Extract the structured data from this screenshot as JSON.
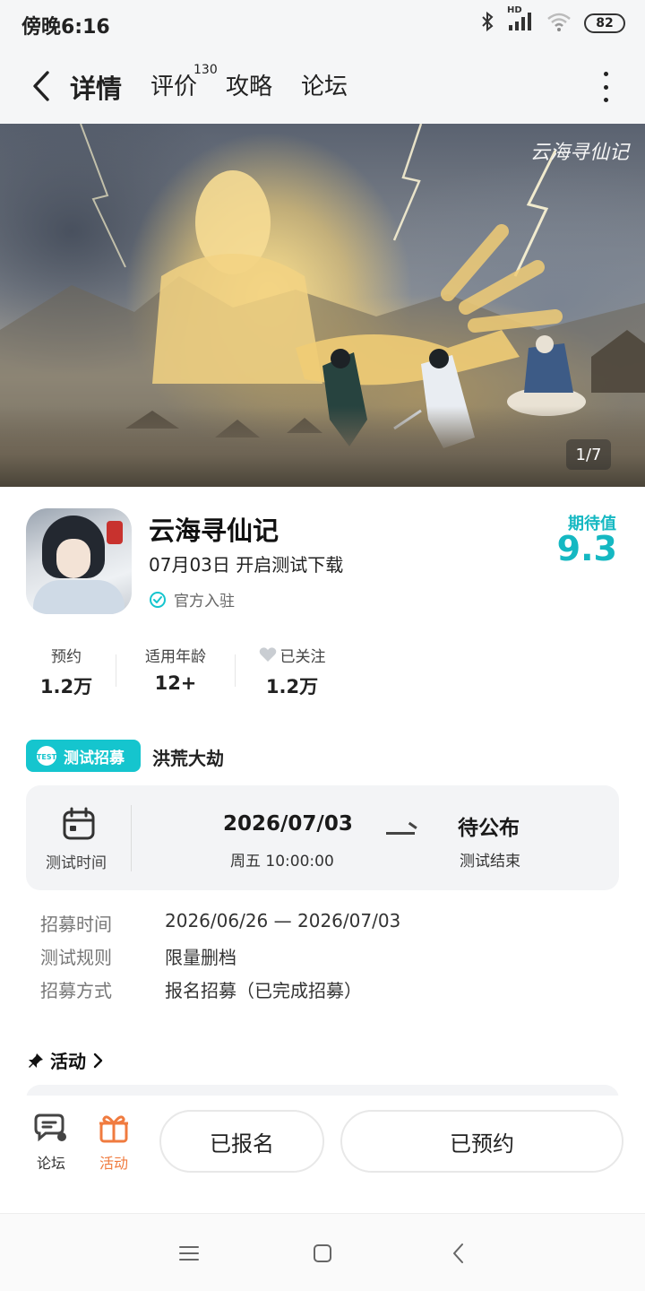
{
  "status_bar": {
    "time": "傍晚6:16",
    "battery": "82",
    "network_label": "HD"
  },
  "nav": {
    "tabs": [
      {
        "label": "详情",
        "active": true
      },
      {
        "label": "评价",
        "badge": "130"
      },
      {
        "label": "攻略"
      },
      {
        "label": "论坛"
      }
    ]
  },
  "banner": {
    "logo_text": "云海寻仙记",
    "counter": "1/7"
  },
  "game": {
    "title": "云海寻仙记",
    "date_text": "07月03日 开启测试下载",
    "official_text": "官方入驻",
    "expect_label": "期待值",
    "expect_value": "9.3"
  },
  "stats": [
    {
      "label": "预约",
      "value": "1.2万"
    },
    {
      "label": "适用年龄",
      "value": "12+"
    },
    {
      "label": "已关注",
      "value": "1.2万"
    }
  ],
  "test": {
    "tag": "测试招募",
    "name": "洪荒大劫",
    "time_label": "测试时间",
    "start_date": "2026/07/03",
    "start_time": "周五  10:00:00",
    "end_status": "待公布",
    "end_label": "测试结束",
    "info": [
      {
        "key": "招募时间",
        "value": "2026/06/26 — 2026/07/03"
      },
      {
        "key": "测试规则",
        "value": "限量删档"
      },
      {
        "key": "招募方式",
        "value": "报名招募（已完成招募）"
      }
    ]
  },
  "activity": {
    "title": "活动"
  },
  "bottom_bar": {
    "forum_label": "论坛",
    "activity_label": "活动",
    "signup_button": "已报名",
    "reserve_button": "已预约"
  },
  "colors": {
    "accent": "#15c5ce",
    "activity": "#f07b3f"
  }
}
